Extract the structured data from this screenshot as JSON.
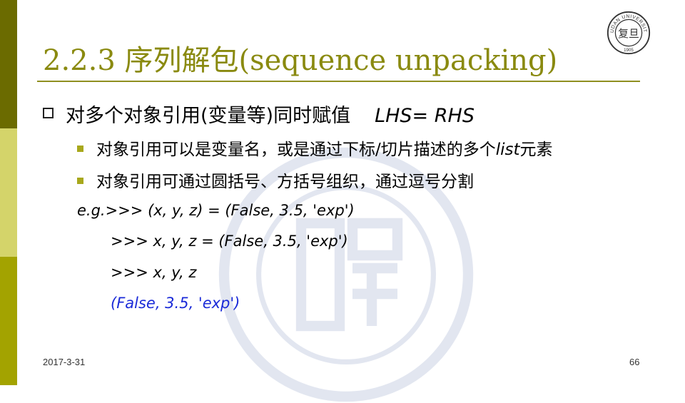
{
  "slide": {
    "title": "2.2.3 序列解包(sequence unpacking)",
    "bullet_main": "对多个对象引用(变量等)同时赋值",
    "bullet_main_formula": "LHS= RHS",
    "sub_bullets": [
      {
        "before": "对象引用可以是变量名，或是通过下标/切片描述的多个",
        "italic": "list",
        "after": "元素"
      },
      {
        "before": "对象引用可通过圆括号、方括号组织，通过逗号分割",
        "italic": "",
        "after": ""
      }
    ],
    "code_lines": [
      "e.g.>>> (x, y, z) = (False, 3.5, 'exp')",
      ">>> x, y, z = (False, 3.5, 'exp')",
      ">>> x, y, z",
      "(False, 3.5, 'exp')"
    ],
    "footer": {
      "date": "2017-3-31",
      "page": "66"
    },
    "logo": {
      "text_top": "FUDAN UNIVERSITY",
      "year": "1905",
      "center_char": "复旦"
    }
  },
  "colors": {
    "sidebar_dark": "#6b6b00",
    "sidebar_light": "#d4d46a",
    "sidebar_mid": "#a3a300",
    "title": "#8a8a10",
    "output": "#1a2ad8"
  }
}
